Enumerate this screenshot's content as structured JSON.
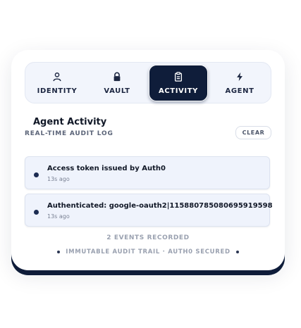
{
  "tabs": {
    "identity": {
      "label": "IDENTITY",
      "icon": "user-icon"
    },
    "vault": {
      "label": "VAULT",
      "icon": "lock-icon"
    },
    "activity": {
      "label": "ACTIVITY",
      "icon": "clipboard-icon",
      "active": true
    },
    "agent": {
      "label": "AGENT",
      "icon": "bolt-icon"
    }
  },
  "activity": {
    "title": "Agent Activity",
    "subtitle": "REAL-TIME AUDIT LOG",
    "clear_label": "CLEAR",
    "events": [
      {
        "message": "Access token issued by Auth0",
        "time": "13s ago"
      },
      {
        "message": "Authenticated: google-oauth2|115880785080695919598",
        "time": "13s ago"
      }
    ],
    "count_text": "2 EVENTS RECORDED",
    "footer_text": "IMMUTABLE AUDIT TRAIL · AUTH0 SECURED"
  },
  "colors": {
    "accent": "#0f1d3a",
    "tab_bar_bg": "#f2f5fc",
    "event_bg": "#eff3fc",
    "muted": "#9aa1b0"
  }
}
